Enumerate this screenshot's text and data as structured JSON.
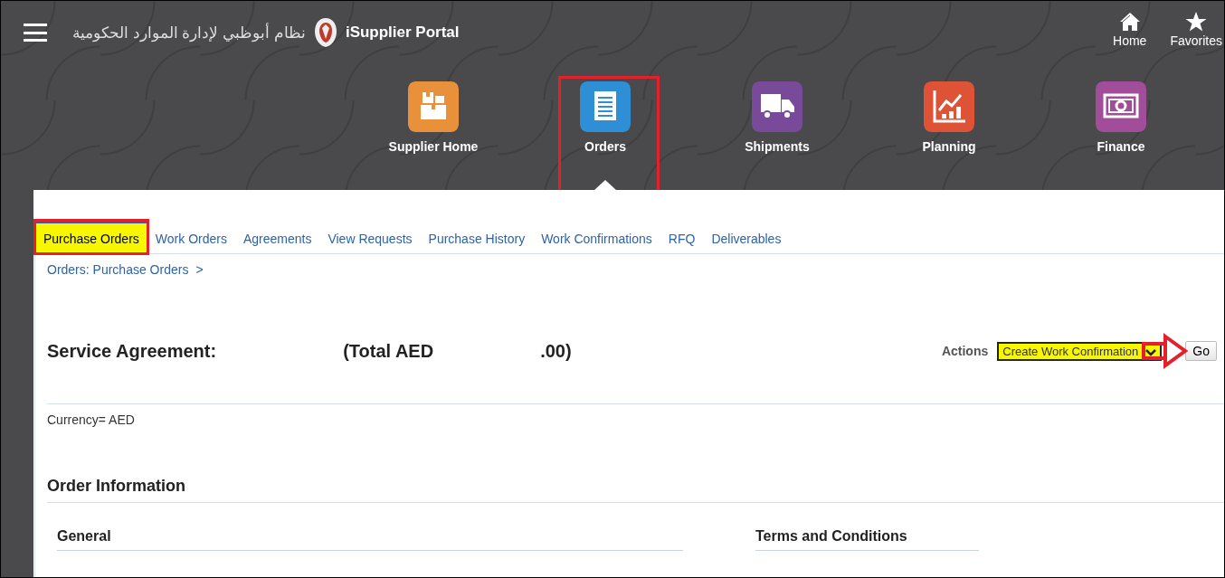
{
  "header": {
    "org_name": "نظام أبوظبي لإدارة الموارد الحكومية",
    "app_title": "iSupplier Portal",
    "links": [
      {
        "label": "Home",
        "kind": "home"
      },
      {
        "label": "Favorites",
        "kind": "favorites"
      }
    ]
  },
  "nav": [
    {
      "label": "Supplier Home",
      "kind": "boxes",
      "color": "#e8913a",
      "selected": false,
      "annotated": false
    },
    {
      "label": "Orders",
      "kind": "document",
      "color": "#2e8fd6",
      "selected": true,
      "annotated": true
    },
    {
      "label": "Shipments",
      "kind": "truck",
      "color": "#7a4a9a",
      "selected": false,
      "annotated": false
    },
    {
      "label": "Planning",
      "kind": "chart",
      "color": "#de5236",
      "selected": false,
      "annotated": false
    },
    {
      "label": "Finance",
      "kind": "money",
      "color": "#a24d9a",
      "selected": false,
      "annotated": false
    }
  ],
  "tabs": [
    {
      "label": "Purchase Orders",
      "selected": true,
      "annotated": true
    },
    {
      "label": "Work Orders",
      "selected": false,
      "annotated": false
    },
    {
      "label": "Agreements",
      "selected": false,
      "annotated": false
    },
    {
      "label": "View Requests",
      "selected": false,
      "annotated": false
    },
    {
      "label": "Purchase History",
      "selected": false,
      "annotated": false
    },
    {
      "label": "Work Confirmations",
      "selected": false,
      "annotated": false
    },
    {
      "label": "RFQ",
      "selected": false,
      "annotated": false
    },
    {
      "label": "Deliverables",
      "selected": false,
      "annotated": false
    }
  ],
  "breadcrumb": {
    "link": "Orders: Purchase Orders",
    "separator": ">"
  },
  "page": {
    "title_parts": [
      "Service Agreement:",
      "(Total AED",
      ".00)"
    ],
    "actions": {
      "label": "Actions",
      "value": "Create Work Confirmation",
      "highlighted": true,
      "button": "Go"
    },
    "currency": "Currency= AED",
    "section": "Order Information",
    "subsections": [
      "General",
      "Terms and Conditions"
    ]
  }
}
